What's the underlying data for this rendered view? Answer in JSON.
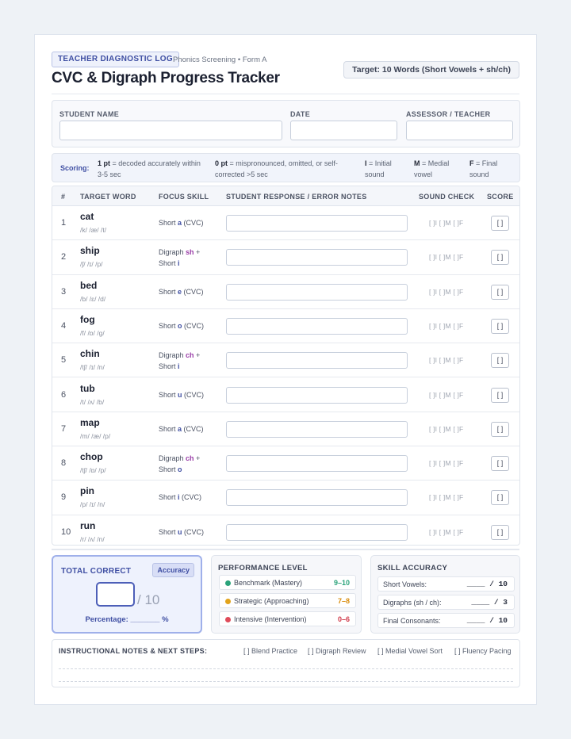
{
  "header": {
    "badge": "TEACHER DIAGNOSTIC LOG",
    "subtitle": "Phonics Screening • Form A",
    "title": "CVC & Digraph Progress Tracker",
    "target": "Target: 10 Words (Short Vowels + sh/ch)"
  },
  "student_info": {
    "name_label": "STUDENT NAME",
    "date_label": "DATE",
    "assessor_label": "ASSESSOR / TEACHER",
    "name_value": "",
    "date_value": "",
    "assessor_value": ""
  },
  "scoring": {
    "label": "Scoring:",
    "one_pt_bold": "1 pt",
    "one_pt_text": " = decoded accurately within 3-5 sec",
    "zero_pt_bold": "0 pt",
    "zero_pt_text": " = mispronounced, omitted, or self-corrected >5 sec",
    "i_bold": "I",
    "i_text": " = Initial sound",
    "m_bold": "M",
    "m_text": " = Medial vowel",
    "f_bold": "F",
    "f_text": " = Final sound"
  },
  "table": {
    "headers": [
      "#",
      "TARGET WORD",
      "FOCUS SKILL",
      "STUDENT RESPONSE / ERROR NOTES",
      "SOUND CHECK",
      "SCORE"
    ],
    "sound_check": "[ ]I [ ]M [ ]F",
    "score_box": "[ ]",
    "rows": [
      {
        "num": "1",
        "word": "cat",
        "phon": "/k/ /æ/ /t/",
        "f1": "Short ",
        "f1h": "a",
        "f1t": " (CVC)",
        "type": "v"
      },
      {
        "num": "2",
        "word": "ship",
        "phon": "/ʃ/ /ɪ/ /p/",
        "f1": "Digraph ",
        "f1h": "sh",
        "f1t": " +",
        "f2": "Short ",
        "f2h": "i",
        "type": "d"
      },
      {
        "num": "3",
        "word": "bed",
        "phon": "/b/ /ɛ/ /d/",
        "f1": "Short ",
        "f1h": "e",
        "f1t": " (CVC)",
        "type": "v"
      },
      {
        "num": "4",
        "word": "fog",
        "phon": "/f/ /ɒ/ /g/",
        "f1": "Short ",
        "f1h": "o",
        "f1t": " (CVC)",
        "type": "v"
      },
      {
        "num": "5",
        "word": "chin",
        "phon": "/tʃ/ /ɪ/ /n/",
        "f1": "Digraph ",
        "f1h": "ch",
        "f1t": " +",
        "f2": "Short ",
        "f2h": "i",
        "type": "d"
      },
      {
        "num": "6",
        "word": "tub",
        "phon": "/t/ /ʌ/ /b/",
        "f1": "Short ",
        "f1h": "u",
        "f1t": " (CVC)",
        "type": "v"
      },
      {
        "num": "7",
        "word": "map",
        "phon": "/m/ /æ/ /p/",
        "f1": "Short ",
        "f1h": "a",
        "f1t": " (CVC)",
        "type": "v"
      },
      {
        "num": "8",
        "word": "chop",
        "phon": "/tʃ/ /ɒ/ /p/",
        "f1": "Digraph ",
        "f1h": "ch",
        "f1t": " +",
        "f2": "Short ",
        "f2h": "o",
        "type": "d"
      },
      {
        "num": "9",
        "word": "pin",
        "phon": "/p/ /ɪ/ /n/",
        "f1": "Short ",
        "f1h": "i",
        "f1t": " (CVC)",
        "type": "v"
      },
      {
        "num": "10",
        "word": "run",
        "phon": "/r/ /ʌ/ /n/",
        "f1": "Short ",
        "f1h": "u",
        "f1t": " (CVC)",
        "type": "v"
      }
    ]
  },
  "total": {
    "label": "TOTAL CORRECT",
    "accuracy_badge": "Accuracy",
    "value": "",
    "out_of": "/ 10",
    "percentage": "Percentage: _______ %"
  },
  "performance": {
    "label": "PERFORMANCE LEVEL",
    "levels": [
      {
        "name": "Benchmark (Mastery)",
        "range": "9–10",
        "color": "#2aa37a"
      },
      {
        "name": "Strategic (Approaching)",
        "range": "7–8",
        "color": "#e2a31b"
      },
      {
        "name": "Intensive (Intervention)",
        "range": "0–6",
        "color": "#e04b5a"
      }
    ]
  },
  "skills": {
    "label": "SKILL ACCURACY",
    "items": [
      {
        "name": "Short Vowels:",
        "val": "____ / 10"
      },
      {
        "name": "Digraphs (sh / ch):",
        "val": "____ / 3"
      },
      {
        "name": "Final Consonants:",
        "val": "____ / 10"
      }
    ]
  },
  "notes": {
    "label": "INSTRUCTIONAL NOTES & NEXT STEPS:",
    "options": [
      "[ ] Blend Practice",
      "[ ] Digraph Review",
      "[ ] Medial Vowel Sort",
      "[ ] Fluency Pacing"
    ]
  },
  "colors": {
    "accent": "#3f4fa3",
    "digraph": "#9a3ea8",
    "benchmark": "#2aa37a",
    "strategic": "#e2a31b",
    "intensive": "#e04b5a"
  }
}
